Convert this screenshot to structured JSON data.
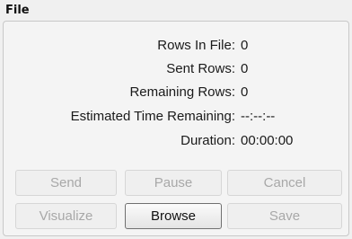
{
  "panel": {
    "title": "File"
  },
  "stats": {
    "rows_in_file": {
      "label": "Rows In File:",
      "value": "0"
    },
    "sent_rows": {
      "label": "Sent Rows:",
      "value": "0"
    },
    "remaining_rows": {
      "label": "Remaining Rows:",
      "value": "0"
    },
    "estimated_time": {
      "label": "Estimated Time Remaining:",
      "value": "--:--:--"
    },
    "duration": {
      "label": "Duration:",
      "value": "00:00:00"
    }
  },
  "buttons": {
    "send": "Send",
    "pause": "Pause",
    "cancel": "Cancel",
    "visualize": "Visualize",
    "browse": "Browse",
    "save": "Save"
  },
  "colors": {
    "disabled_text": "#a8a8a8",
    "enabled_border": "#707070"
  }
}
